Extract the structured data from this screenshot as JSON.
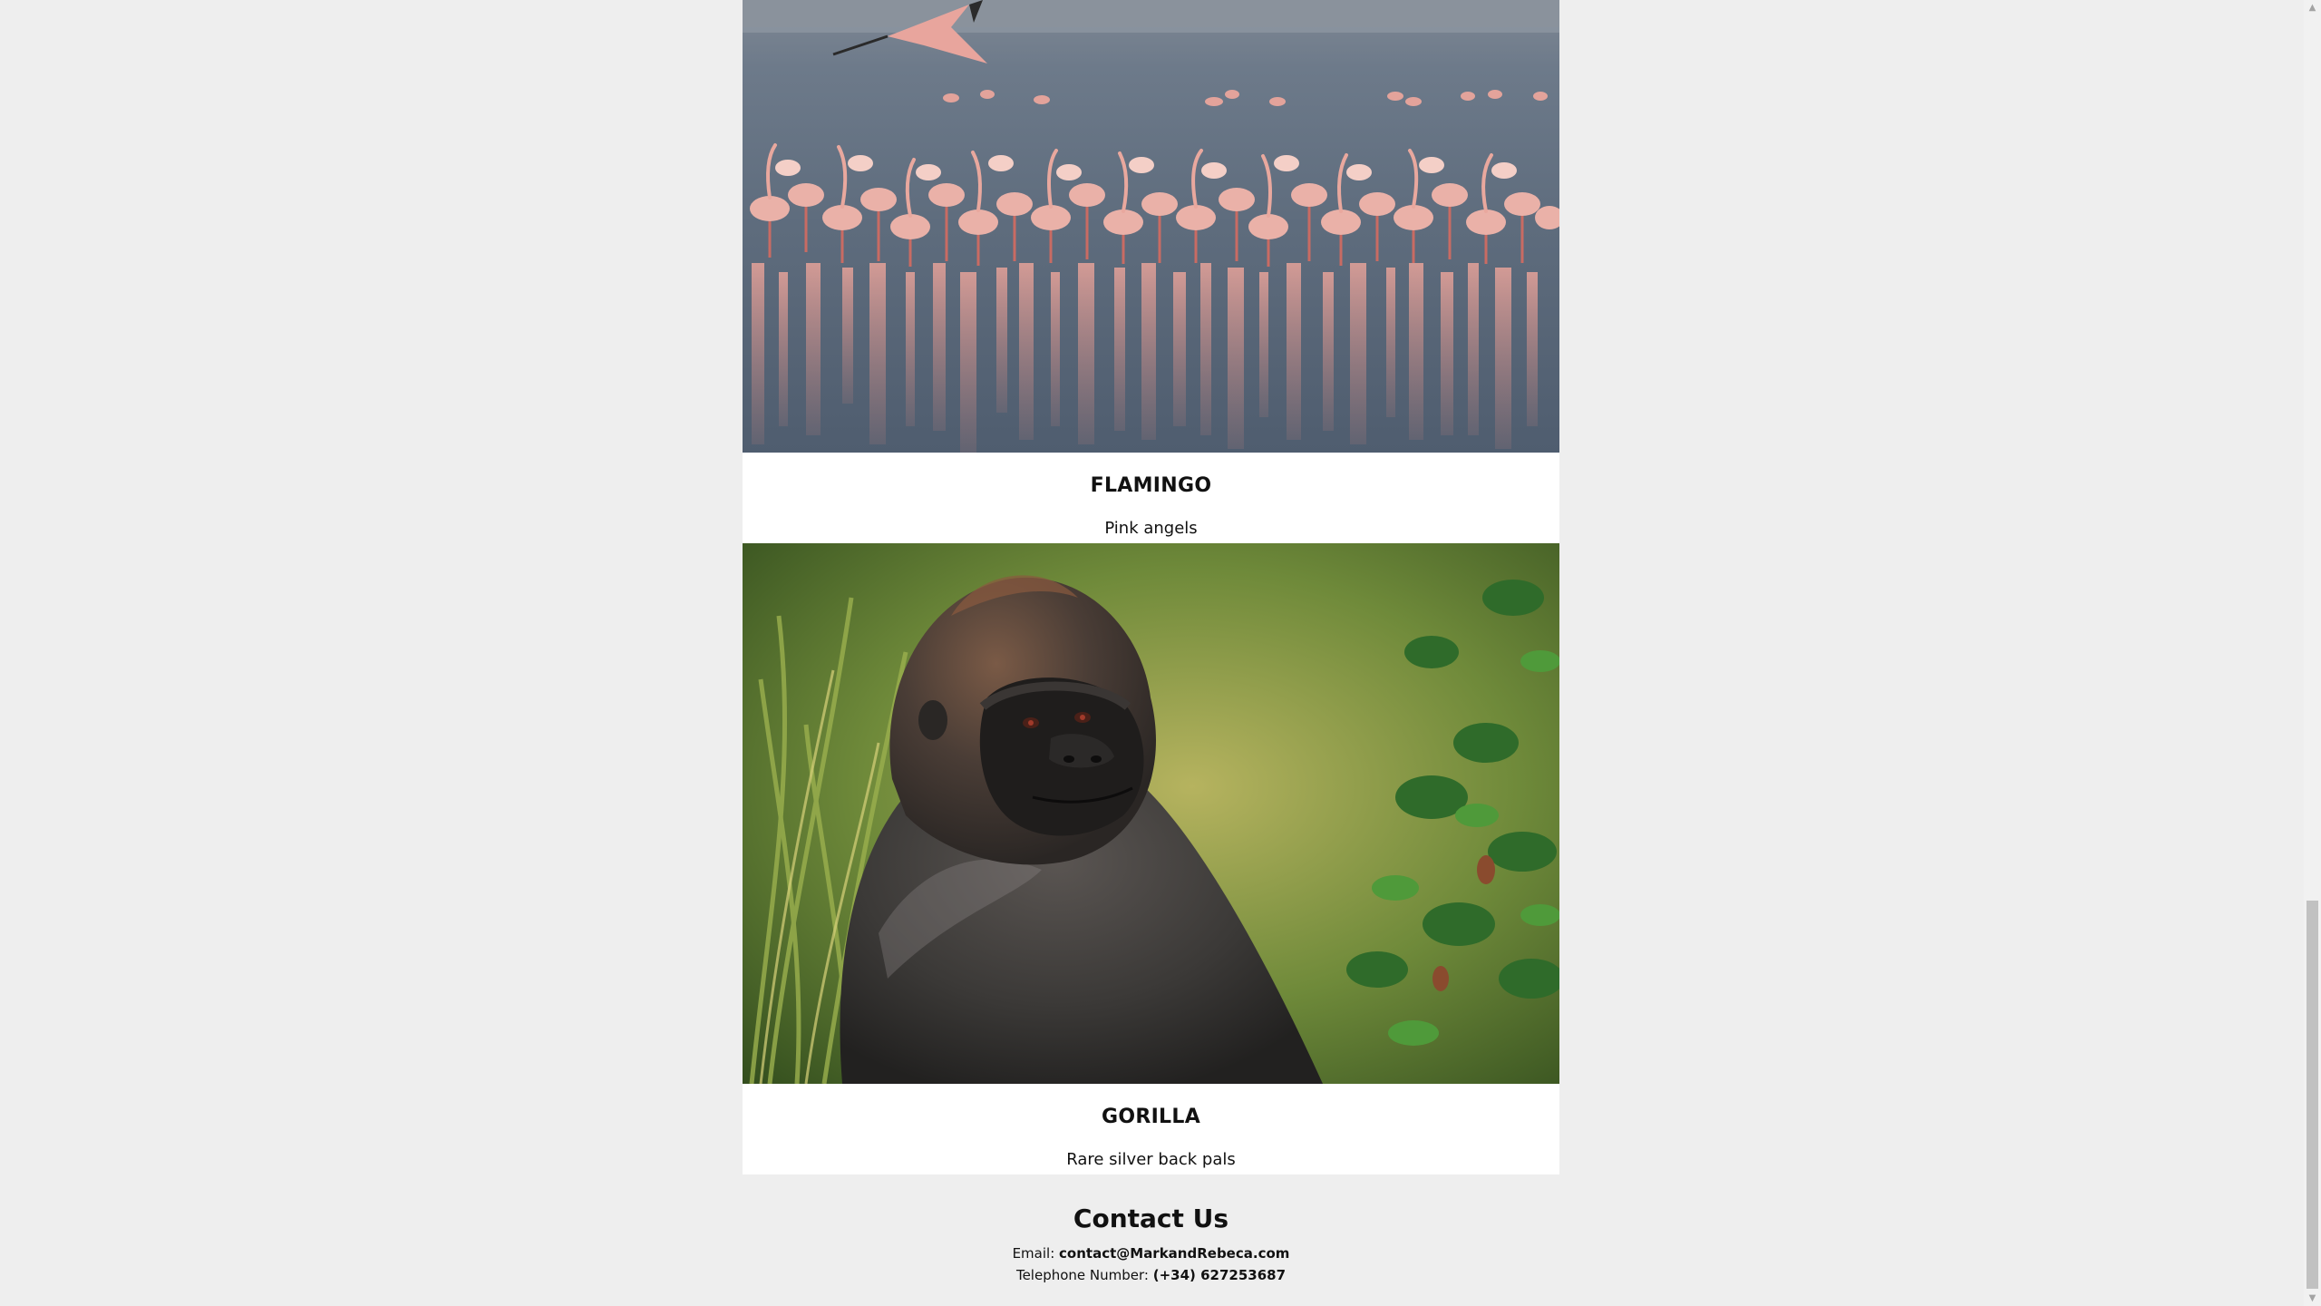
{
  "cards": [
    {
      "title": "FLAMINGO",
      "description": "Pink angels",
      "image_icon": "flamingo-photo"
    },
    {
      "title": "GORILLA",
      "description": "Rare silver back pals",
      "image_icon": "gorilla-photo"
    }
  ],
  "contact": {
    "title": "Contact Us",
    "email_label": "Email: ",
    "email_value": "contact@MarkandRebeca.com",
    "phone_label": "Telephone Number: ",
    "phone_value": "(+34) 627253687"
  },
  "scrollbar": {
    "up_arrow": "▲",
    "down_arrow": "▼"
  }
}
